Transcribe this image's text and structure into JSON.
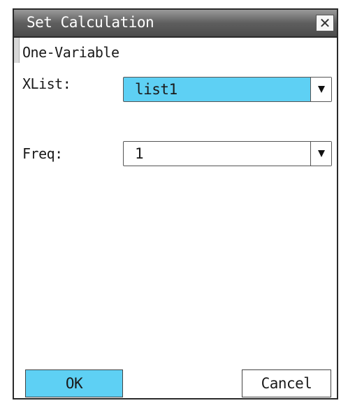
{
  "dialog": {
    "title": "Set Calculation",
    "close_icon": "close-icon",
    "close_glyph": "✕",
    "section_label": "One-Variable",
    "fields": [
      {
        "label": "XList:",
        "value": "list1",
        "selected": true
      },
      {
        "label": "Freq:",
        "value": "1",
        "selected": false
      }
    ],
    "buttons": {
      "ok_label": "OK",
      "cancel_label": "Cancel"
    }
  },
  "colors": {
    "accent": "#5ed0f4",
    "titlebar": "#5e5e5e",
    "border": "#2a2a2a"
  }
}
